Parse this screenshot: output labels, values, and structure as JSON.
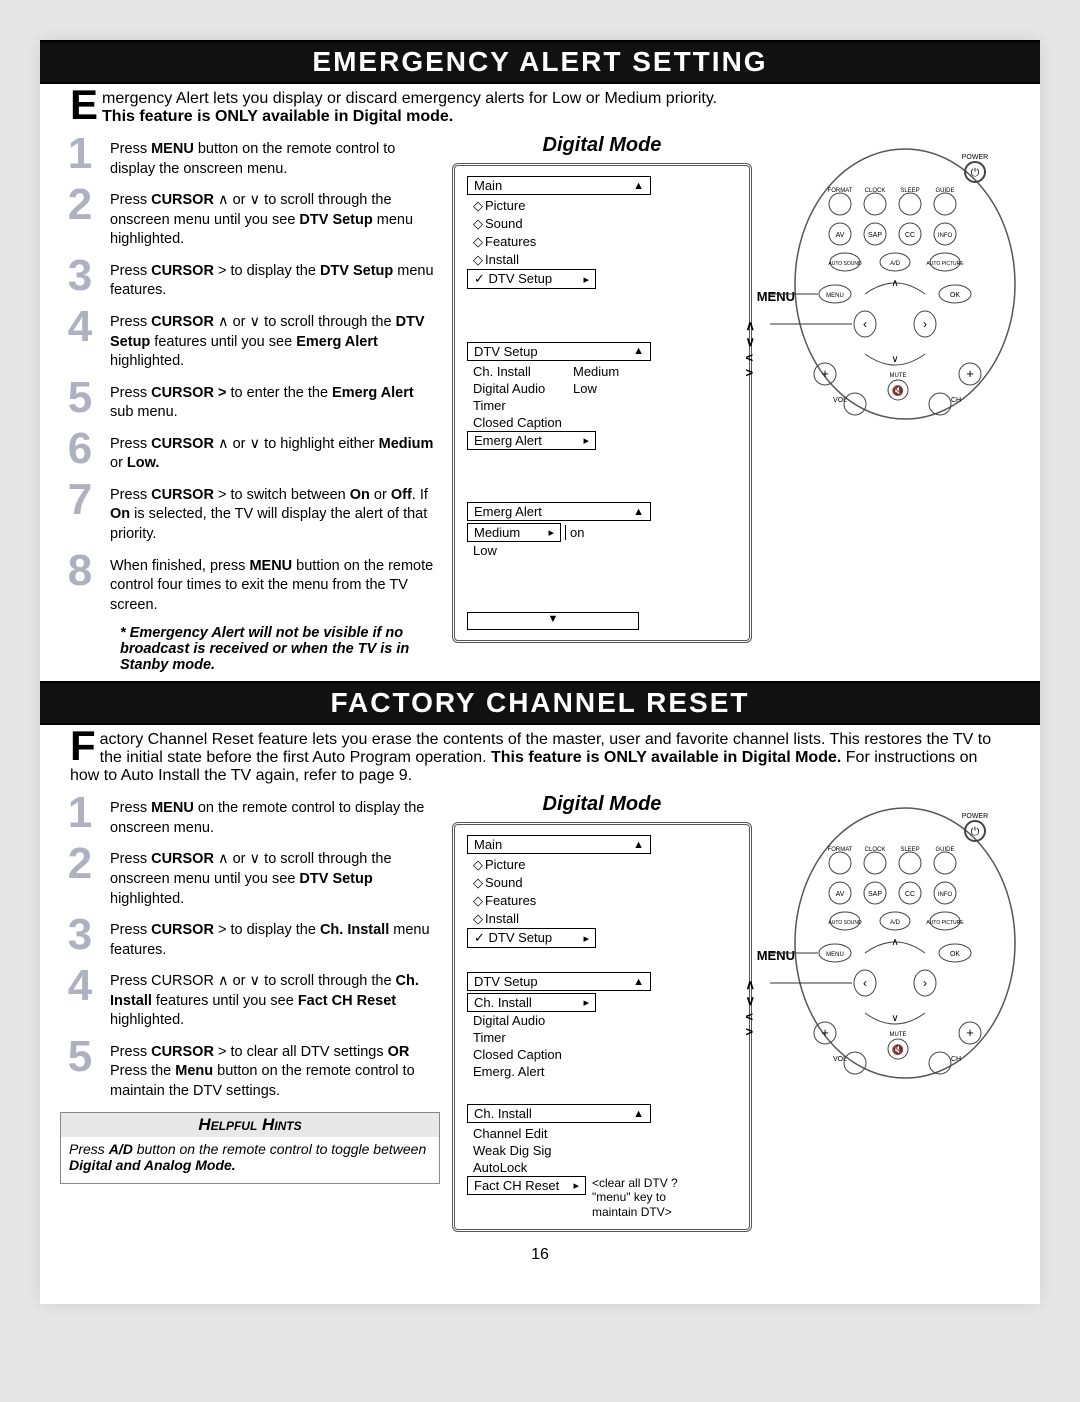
{
  "section1": {
    "title": "EMERGENCY ALERT SETTING",
    "drop": "E",
    "intro_rest": "mergency Alert lets you display or discard emergency alerts for Low or Medium priority.",
    "intro_bold": "This feature is ONLY available in Digital mode.",
    "steps": [
      {
        "n": "1",
        "pre": "Press ",
        "b1": "MENU",
        "mid": " button on the remote control to display the onscreen menu.",
        "post": ""
      },
      {
        "n": "2",
        "pre": "Press ",
        "b1": "CURSOR",
        "mid": " ∧ or ∨  to scroll through the onscreen menu until you see ",
        "b2": "DTV Setup",
        "post": " menu highlighted."
      },
      {
        "n": "3",
        "pre": "Press ",
        "b1": "CURSOR",
        "mid": "  > to display the ",
        "b2": "DTV Setup",
        "post": " menu features."
      },
      {
        "n": "4",
        "pre": "Press ",
        "b1": "CURSOR",
        "mid": " ∧ or ∨ to scroll through the ",
        "b2": "DTV Setup",
        "post2": " features until you see ",
        "b3": "Emerg Alert",
        "post": " highlighted."
      },
      {
        "n": "5",
        "pre": "Press ",
        "b1": "CURSOR >",
        "mid": " to enter the the ",
        "b2": "Emerg Alert",
        "post": " sub menu."
      },
      {
        "n": "6",
        "pre": "Press ",
        "b1": "CURSOR",
        "mid": " ∧ or ∨  to highlight either ",
        "b2": "Medium",
        "post2": " or ",
        "b3": "Low.",
        "post": ""
      },
      {
        "n": "7",
        "pre": "Press ",
        "b1": "CURSOR",
        "mid": "  >  to switch between ",
        "b2": "On",
        "post2": " or ",
        "b3": "Off",
        "post": ". If ",
        "b4": "On",
        "post3": " is selected, the TV will display the alert of that priority."
      },
      {
        "n": "8",
        "pre": "When finished, press ",
        "b1": "MENU",
        "mid": " buttion on the remote control four times to exit the menu from the TV screen.",
        "post": ""
      }
    ],
    "footnote": "* Emergency Alert will not be visible if no broadcast is received or when the TV is in Stanby mode.",
    "dm_title": "Digital Mode",
    "menu1": {
      "title": "Main",
      "items": [
        "Picture",
        "Sound",
        "Features",
        "Install"
      ],
      "sel": "DTV Setup"
    },
    "menu2": {
      "title": "DTV Setup",
      "rows": [
        {
          "l": "Ch. Install",
          "v": "Medium"
        },
        {
          "l": "Digital Audio",
          "v": "Low"
        },
        {
          "l": "Timer",
          "v": ""
        },
        {
          "l": "Closed Caption",
          "v": ""
        }
      ],
      "sel": "Emerg Alert"
    },
    "menu3": {
      "title": "Emerg Alert",
      "row1": {
        "l": "Medium",
        "v": "on"
      },
      "row2": "Low"
    },
    "remote": {
      "menu": "MENU",
      "cursor": "∧  ∨  <  >",
      "btns": {
        "power": "POWER",
        "format": "FORMAT",
        "clock": "CLOCK",
        "sleep": "SLEEP",
        "guide": "GUIDE",
        "av": "AV",
        "sap": "SAP",
        "cc": "CC",
        "info": "INFO",
        "as": "AUTO SOUND",
        "ad": "A/D",
        "ap": "AUTO PICTURE",
        "menu": "MENU",
        "ok": "OK",
        "mute": "MUTE",
        "vol": "VOL",
        "ch": "CH"
      }
    }
  },
  "section2": {
    "title": "FACTORY CHANNEL RESET",
    "drop": "F",
    "intro_rest": "actory Channel Reset feature lets you erase the contents of the master, user and favorite channel lists.  This restores the TV to the initial state before the first Auto Program operation.  ",
    "intro_bold": "This feature is ONLY available in Digital Mode.",
    "intro_tail": "   For instructions on how to Auto Install the TV again, refer to page 9.",
    "steps": [
      {
        "n": "1",
        "pre": "Press ",
        "b1": "MENU",
        "mid": " on the remote control to display the onscreen menu.",
        "post": ""
      },
      {
        "n": "2",
        "pre": "Press ",
        "b1": "CURSOR",
        "mid": " ∧ or  ∨ to scroll through the onscreen menu until you see ",
        "b2": "DTV Setup",
        "post": " highlighted."
      },
      {
        "n": "3",
        "pre": "Press ",
        "b1": "CURSOR",
        "mid": "  >  to display the ",
        "b2": "Ch. Install",
        "post": " menu features."
      },
      {
        "n": "4",
        "pre": "Press CURSOR ∧ or  ∨ to scroll through the ",
        "b1": "Ch. Install",
        "mid": " features until you see ",
        "b2": "Fact CH Reset",
        "post": " highlighted."
      },
      {
        "n": "5",
        "pre": "Press ",
        "b1": "CURSOR",
        "mid": "  >  to clear all DTV settings ",
        "b2": "OR",
        "post2": "  Press the ",
        "b3": "Menu",
        "post": " button on the remote control to maintain the DTV settings."
      }
    ],
    "hints_title": "Helpful Hints",
    "hints_body_pre": "Press ",
    "hints_body_b": "A/D",
    "hints_body_mid": " button on the remote control to toggle between ",
    "hints_body_b2": "Digital and Analog Mode.",
    "dm_title": "Digital Mode",
    "menu1": {
      "title": "Main",
      "items": [
        "Picture",
        "Sound",
        "Features",
        "Install"
      ],
      "sel": "DTV Setup"
    },
    "menu2": {
      "title": "DTV Setup",
      "sel": "Ch. Install",
      "rows": [
        "Digital Audio",
        "Timer",
        "Closed Caption",
        "Emerg. Alert"
      ]
    },
    "menu3": {
      "title": "Ch. Install",
      "rows": [
        "Channel Edit",
        "Weak Dig Sig",
        "AutoLock"
      ],
      "sel": "Fact CH Reset",
      "note": "<clear all DTV ? \"menu\" key to maintain DTV>"
    }
  },
  "page_num": "16"
}
